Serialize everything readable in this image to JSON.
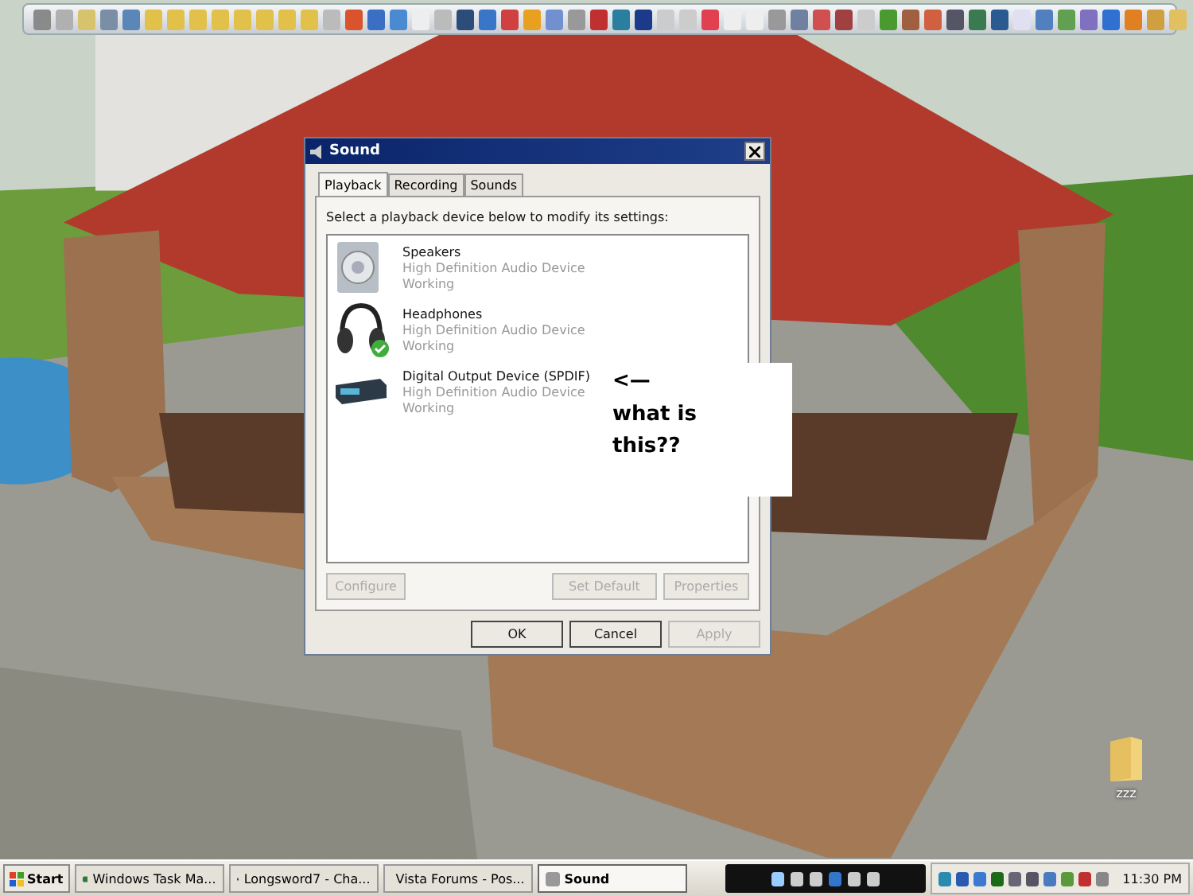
{
  "desktop": {
    "kind": "picture",
    "icons": [
      {
        "label": "zzz"
      }
    ]
  },
  "dialog": {
    "title": "Sound",
    "tabs": [
      {
        "label": "Playback",
        "selected": true
      },
      {
        "label": "Recording",
        "selected": false
      },
      {
        "label": "Sounds",
        "selected": false
      }
    ],
    "instruction": "Select a playback device below to modify its settings:",
    "devices": [
      {
        "kind": "speaker",
        "name": "Speakers",
        "driver": "High Definition Audio Device",
        "status": "Working",
        "default": false
      },
      {
        "kind": "headphones",
        "name": "Headphones",
        "driver": "High Definition Audio Device",
        "status": "Working",
        "default": true
      },
      {
        "kind": "digital",
        "name": "Digital Output Device (SPDIF)",
        "driver": "High Definition Audio Device",
        "status": "Working",
        "default": false
      }
    ],
    "device_buttons": [
      {
        "label": "Configure",
        "disabled": true
      },
      {
        "label": "Set Default",
        "disabled": true
      },
      {
        "label": "Properties",
        "disabled": true
      }
    ],
    "footer_buttons": [
      {
        "label": "OK",
        "disabled": false
      },
      {
        "label": "Cancel",
        "disabled": false
      },
      {
        "label": "Apply",
        "disabled": true
      }
    ]
  },
  "annotation": {
    "arrow": "<—",
    "text": "what is this??"
  },
  "taskbar": {
    "start": "Start",
    "tasks": [
      {
        "label": "Windows Task Ma...",
        "selected": false
      },
      {
        "label": "Longsword7 - Cha...",
        "selected": false
      },
      {
        "label": "Vista Forums - Pos...",
        "selected": false
      },
      {
        "label": "Sound",
        "selected": true
      }
    ],
    "clock": "11:30 PM"
  }
}
